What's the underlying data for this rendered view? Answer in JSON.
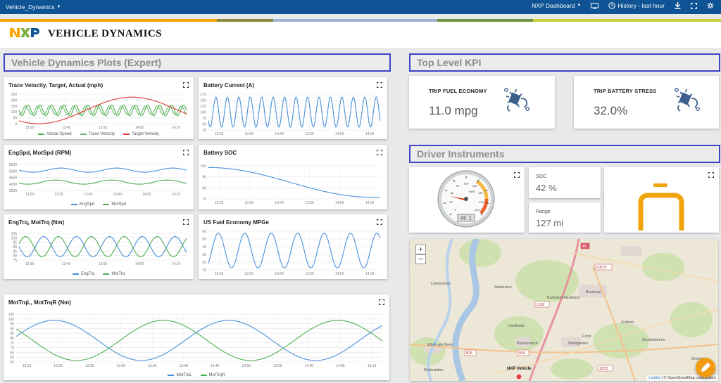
{
  "topbar": {
    "app_name": "Vehicle_Dynamics",
    "dashboard_menu": "NXP Dashboard",
    "history": "History - last hour"
  },
  "banner": {
    "logo_text": "NXP",
    "title": "VEHICLE DYNAMICS",
    "stripe_colors": [
      "#f7a600",
      "#8a8a42",
      "#9fb6d8",
      "#6f9445",
      "#c9ce3c"
    ]
  },
  "sections": {
    "plots": "Vehicle Dynamics Plots (Expert)",
    "kpi": "Top Level KPI",
    "instruments": "Driver Instruments"
  },
  "plots": {
    "trace_velocity": {
      "title": "Trace Velocity, Target, Actual (mph)",
      "yticks": [
        "250",
        "200",
        "150",
        "100",
        "50",
        "0"
      ],
      "xticks": [
        "13:30",
        "13:40",
        "13:50",
        "14:00",
        "14:10"
      ],
      "legend": [
        "Actual Speed",
        "Trace Velocity",
        "Target Velocity"
      ]
    },
    "battery_current": {
      "title": "Battery Current (A)",
      "yticks": [
        "175",
        "150",
        "125",
        "100",
        "75",
        "50",
        "25"
      ],
      "xticks": [
        "13:20",
        "13:30",
        "13:40",
        "13:50",
        "14:00",
        "14:10"
      ]
    },
    "engspd": {
      "title": "EngSpd, MotSpd (RPM)",
      "yticks": [
        "5500",
        "5000",
        "4500",
        "4000",
        "3500"
      ],
      "xticks": [
        "13:20",
        "13:30",
        "13:40",
        "13:50",
        "14:00",
        "14:10"
      ],
      "legend": [
        "EngSpd",
        "MotSpd"
      ]
    },
    "battery_soc": {
      "title": "Battery SOC",
      "yticks": [
        "100",
        "90",
        "80",
        "70"
      ],
      "xticks": [
        "13:20",
        "13:30",
        "13:40",
        "13:50",
        "14:00",
        "14:10"
      ]
    },
    "engtrq": {
      "title": "EngTrq, MotTrq (Nm)",
      "yticks": [
        "105",
        "100",
        "95",
        "90",
        "85",
        "80",
        "75"
      ],
      "xticks": [
        "13:30",
        "13:40",
        "13:50",
        "14:00",
        "14:10"
      ],
      "legend": [
        "EngTrq",
        "MotTrq"
      ]
    },
    "fuel_economy": {
      "title": "US Fuel Economy MPGe",
      "yticks": [
        "60",
        "50",
        "40",
        "30",
        "20",
        "10"
      ],
      "xticks": [
        "13:20",
        "13:30",
        "13:40",
        "13:50",
        "14:00",
        "14:10"
      ]
    },
    "mottrq": {
      "title": "MotTrqL, MotTrqR (Nm)",
      "yticks": [
        "105",
        "100",
        "95",
        "90",
        "85",
        "80",
        "75",
        "70",
        "65",
        "60",
        "55"
      ],
      "xticks": [
        "13:15",
        "13:20",
        "13:25",
        "13:30",
        "13:35",
        "13:40",
        "13:45",
        "13:50",
        "13:55",
        "14:00",
        "14:05",
        "14:10"
      ],
      "legend": [
        "MotTrqL",
        "MotTrqR"
      ]
    }
  },
  "kpi": {
    "trip_fuel": {
      "label": "TRIP FUEL ECONOMY",
      "value": "11.0 mpg"
    },
    "trip_battery": {
      "label": "TRIP BATTERY STRESS",
      "value": "32.0%"
    }
  },
  "instruments": {
    "gauge_unit": "mph",
    "gauge_readout": "05 I",
    "gauge_ticks": [
      "0",
      "30",
      "60",
      "90",
      "120",
      "150",
      "180",
      "210",
      "240"
    ],
    "soc_label": "SOC",
    "soc_value": "42 %",
    "range_label": "Range",
    "range_value": "127 mi",
    "battery_level": 0.42
  },
  "map": {
    "zoom_in": "+",
    "zoom_out": "−",
    "vehicle_label": "NXP Vehicle",
    "places": [
      "Bruchsal",
      "Karlsdorf-Neuthard",
      "Forst",
      "Weingarten",
      "Blankenloch",
      "Linkenheim",
      "Stutensee",
      "Graben",
      "Gondelsheim",
      "Bretten",
      "Hardtwald",
      "Wörth am Rhein",
      "Rheinstetten"
    ],
    "roads": [
      "A5",
      "B35",
      "B36",
      "L558",
      "K3575",
      "B293"
    ],
    "attrib_leaflet": "Leaflet",
    "attrib_osm": "© OpenStreetMap contributors"
  },
  "colors": {
    "topbar": "#0e5393",
    "green": "#4caf50",
    "blue": "#4a90d9",
    "red": "#e53935",
    "accent": "#f39c12",
    "section_border": "#3f44c7"
  }
}
